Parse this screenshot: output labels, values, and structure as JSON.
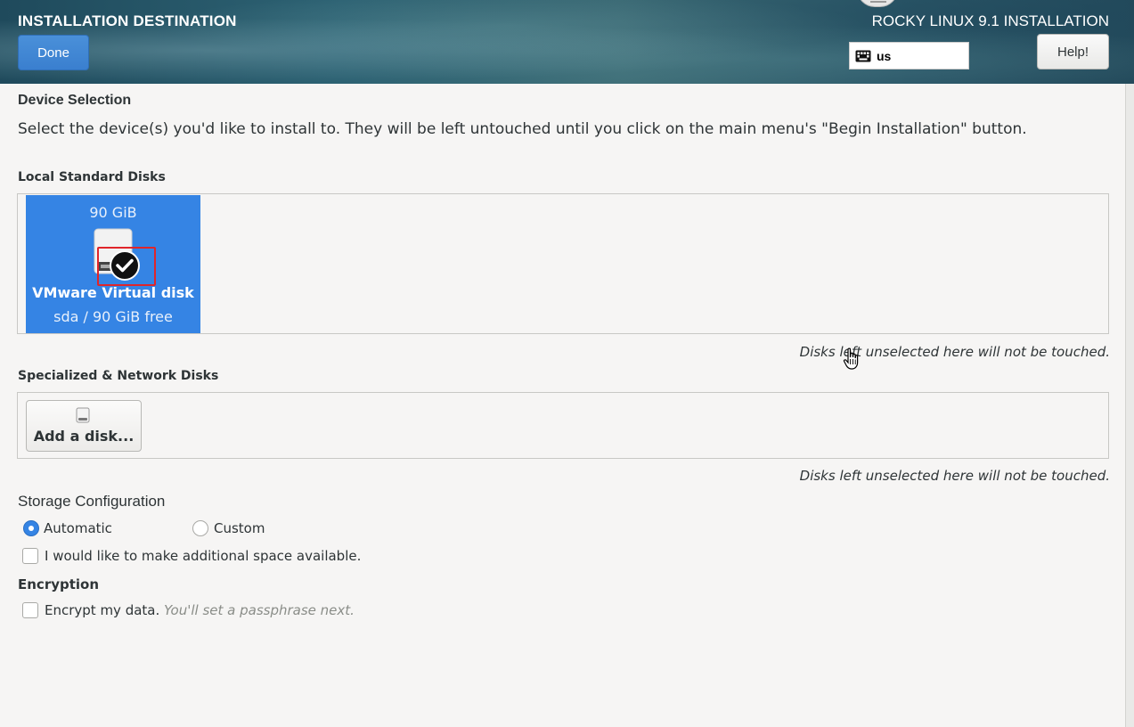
{
  "header": {
    "page_title": "INSTALLATION DESTINATION",
    "done_label": "Done",
    "product_title": "ROCKY LINUX 9.1 INSTALLATION",
    "keyboard_layout": "us",
    "help_label": "Help!"
  },
  "device_selection": {
    "title": "Device Selection",
    "description": "Select the device(s) you'd like to install to.  They will be left untouched until you click on the main menu's \"Begin Installation\" button."
  },
  "local_disks": {
    "heading": "Local Standard Disks",
    "disks": [
      {
        "size": "90 GiB",
        "name": "VMware Virtual disk",
        "detail": "sda  /  90 GiB free",
        "selected": true
      }
    ],
    "note": "Disks left unselected here will not be touched."
  },
  "network_disks": {
    "heading": "Specialized & Network Disks",
    "add_label": "Add a disk...",
    "note": "Disks left unselected here will not be touched."
  },
  "storage": {
    "title": "Storage Configuration",
    "automatic_label": "Automatic",
    "custom_label": "Custom",
    "selected": "Automatic",
    "space_label": "I would like to make additional space available."
  },
  "encryption": {
    "title": "Encryption",
    "encrypt_label": "Encrypt my data.",
    "encrypt_hint": "You'll set a passphrase next."
  },
  "colors": {
    "accent": "#3584e4",
    "highlight": "#e0252a"
  }
}
